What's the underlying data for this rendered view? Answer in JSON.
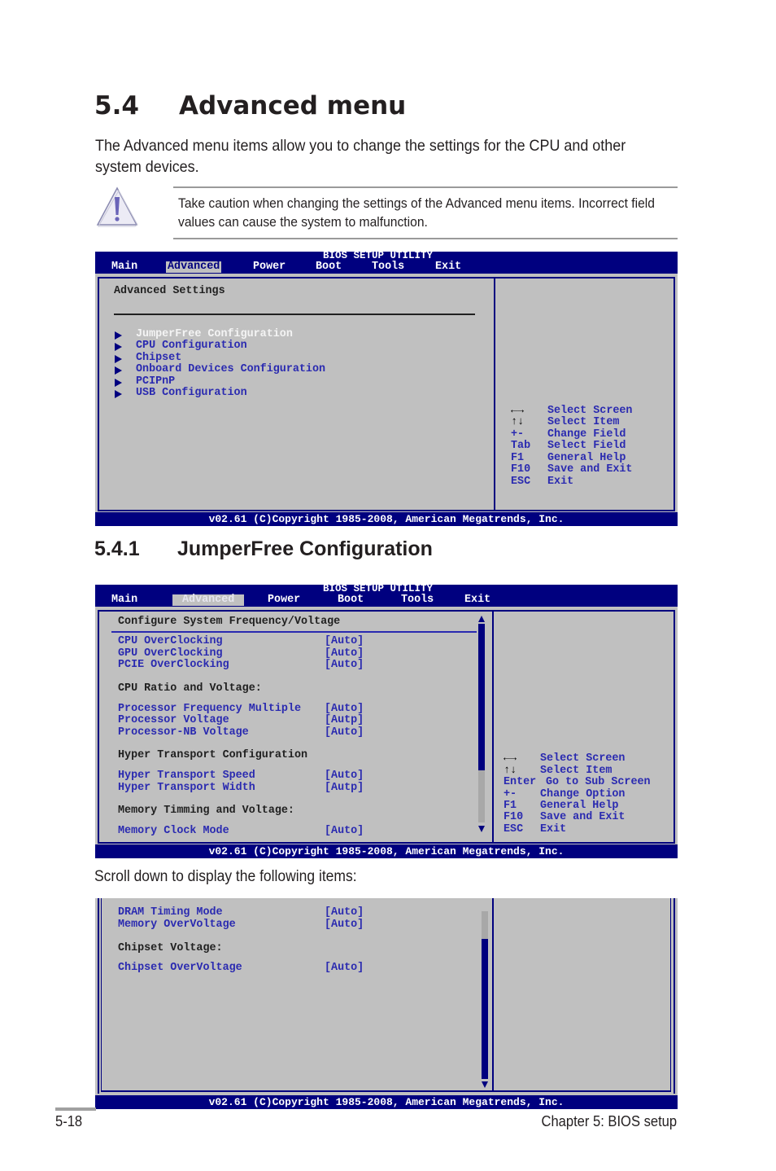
{
  "section": {
    "number": "5.4",
    "title": "Advanced menu",
    "intro": "The Advanced menu items allow you to change the settings for the CPU and other system devices.",
    "caution": "Take caution when changing the settings of the Advanced menu items. Incorrect field values can cause the system to malfunction.",
    "caution_icon": "warning-triangle-icon"
  },
  "bios1": {
    "title": "BIOS SETUP UTILITY",
    "menu": [
      "Main",
      "Advanced",
      "Power",
      "Boot",
      "Tools",
      "Exit"
    ],
    "active_menu": "Advanced",
    "heading": "Advanced Settings",
    "items": [
      {
        "label": "JumperFree Configuration",
        "selected": true
      },
      {
        "label": "CPU Configuration",
        "selected": false
      },
      {
        "label": "Chipset",
        "selected": false
      },
      {
        "label": "Onboard Devices Configuration",
        "selected": false
      },
      {
        "label": "PCIPnP",
        "selected": false
      },
      {
        "label": "USB Configuration",
        "selected": false
      }
    ],
    "keys": [
      {
        "key": "←→",
        "desc": "Select Screen"
      },
      {
        "key": "↑↓",
        "desc": "Select Item"
      },
      {
        "key": "+-",
        "desc": "Change Field"
      },
      {
        "key": "Tab",
        "desc": "Select Field"
      },
      {
        "key": "F1",
        "desc": "General Help"
      },
      {
        "key": "F10",
        "desc": "Save and Exit"
      },
      {
        "key": "ESC",
        "desc": "Exit"
      }
    ],
    "footer": "v02.61 (C)Copyright 1985-2008, American Megatrends, Inc."
  },
  "subsection": {
    "number": "5.4.1",
    "title": "JumperFree Configuration"
  },
  "bios2": {
    "title": "BIOS SETUP UTILITY",
    "menu": [
      "Main",
      "Advanced",
      "Power",
      "Boot",
      "Tools",
      "Exit"
    ],
    "active_menu": "Advanced",
    "heading": "Configure System Frequency/Voltage",
    "rows": [
      {
        "type": "item",
        "label": "CPU OverClocking",
        "value": "[Auto]"
      },
      {
        "type": "item",
        "label": "GPU OverClocking",
        "value": "[Auto]"
      },
      {
        "type": "item",
        "label": "PCIE OverClocking",
        "value": "[Auto]"
      },
      {
        "type": "group",
        "label": "CPU Ratio and Voltage:"
      },
      {
        "type": "item",
        "label": "Processor Frequency Multiple",
        "value": "[Auto]"
      },
      {
        "type": "item",
        "label": "Processor Voltage",
        "value": "[Autp]"
      },
      {
        "type": "item",
        "label": "Processor-NB Voltage",
        "value": "[Auto]"
      },
      {
        "type": "group",
        "label": "Hyper Transport Configuration"
      },
      {
        "type": "item",
        "label": "Hyper Transport Speed",
        "value": "[Auto]"
      },
      {
        "type": "item",
        "label": "Hyper Transport Width",
        "value": "[Autp]"
      },
      {
        "type": "group",
        "label": "Memory Timming and Voltage:"
      },
      {
        "type": "item",
        "label": "Memory Clock Mode",
        "value": "[Auto]"
      }
    ],
    "keys": [
      {
        "key": "←→",
        "desc": "Select Screen"
      },
      {
        "key": "↑↓",
        "desc": "Select Item"
      },
      {
        "key": "Enter",
        "desc": "Go to Sub Screen"
      },
      {
        "key": "+-",
        "desc": "Change Option"
      },
      {
        "key": "F1",
        "desc": "General Help"
      },
      {
        "key": "F10",
        "desc": "Save and Exit"
      },
      {
        "key": "ESC",
        "desc": "Exit"
      }
    ],
    "scroll_position": "top",
    "footer": "v02.61 (C)Copyright 1985-2008, American Megatrends, Inc."
  },
  "scroll_note": "Scroll down to display the following items:",
  "bios3": {
    "rows": [
      {
        "type": "item",
        "label": "DRAM Timing Mode",
        "value": "[Auto]"
      },
      {
        "type": "item",
        "label": "Memory OverVoltage",
        "value": "[Auto]"
      },
      {
        "type": "group",
        "label": "Chipset Voltage:"
      },
      {
        "type": "item",
        "label": "Chipset OverVoltage",
        "value": "[Auto]"
      }
    ],
    "scroll_position": "bottom",
    "footer": "v02.61 (C)Copyright 1985-2008, American Megatrends, Inc."
  },
  "page_footer": {
    "page_number": "5-18",
    "chapter": "Chapter 5: BIOS setup"
  }
}
